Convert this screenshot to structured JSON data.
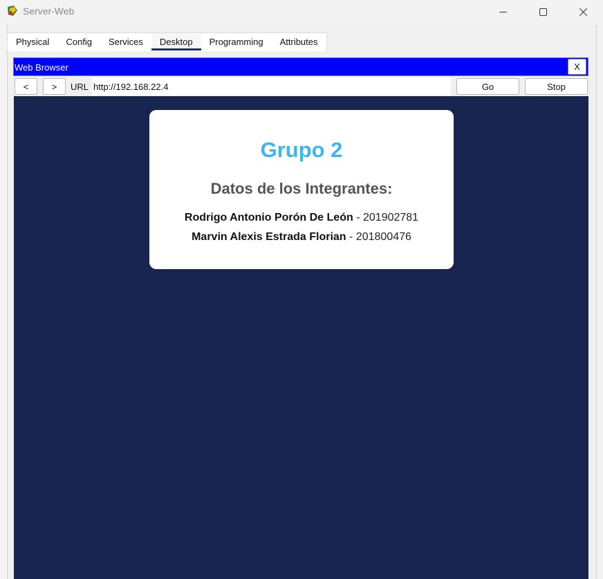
{
  "window": {
    "title": "Server-Web",
    "icon": "packet-tracer-server-icon"
  },
  "tabs": [
    {
      "label": "Physical",
      "active": false
    },
    {
      "label": "Config",
      "active": false
    },
    {
      "label": "Services",
      "active": false
    },
    {
      "label": "Desktop",
      "active": true
    },
    {
      "label": "Programming",
      "active": false
    },
    {
      "label": "Attributes",
      "active": false
    }
  ],
  "browser": {
    "title": "Web Browser",
    "close_label": "X",
    "back_label": "<",
    "forward_label": ">",
    "url_label": "URL",
    "url_value": "http://192.168.22.4",
    "go_label": "Go",
    "stop_label": "Stop"
  },
  "page": {
    "heading": "Grupo 2",
    "subheading": "Datos de los Integrantes:",
    "members": [
      {
        "name": "Rodrigo Antonio Porón De León",
        "separator": " - ",
        "id": "201902781"
      },
      {
        "name": "Marvin Alexis Estrada Florian",
        "separator": " - ",
        "id": "201800476"
      }
    ]
  },
  "colors": {
    "browser_bar": "#0000ff",
    "page_background": "#172550",
    "heading": "#3eb5ef",
    "active_tab_underline": "#1b2f5c"
  }
}
